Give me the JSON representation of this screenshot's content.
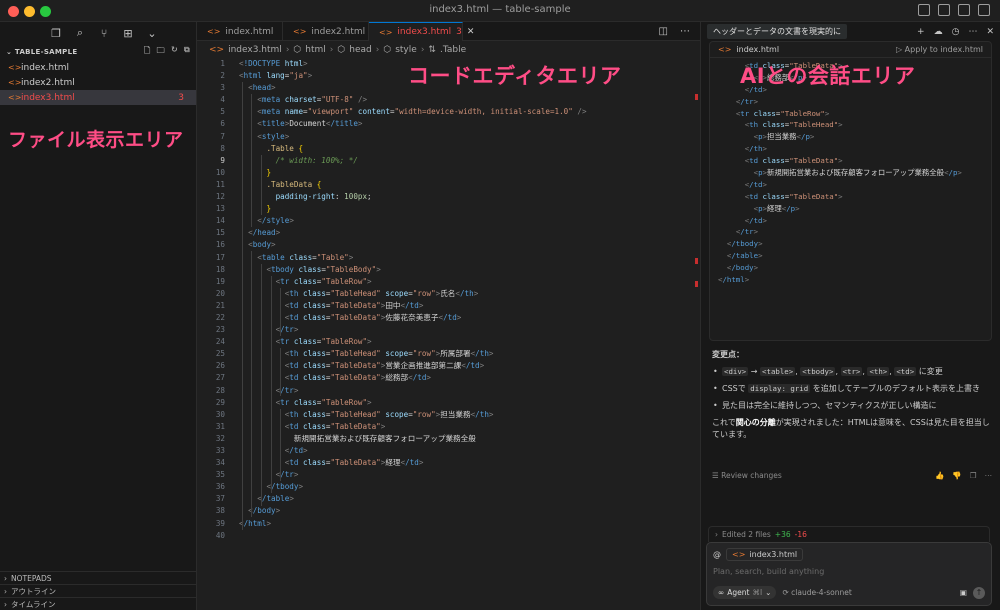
{
  "window": {
    "title": "index3.html — table-sample"
  },
  "colors": {
    "accent": "#0078d4",
    "error": "#f14c4c",
    "annotation": "#ff4d86",
    "html_icon": "#e37933"
  },
  "activity_icons": [
    "copy-icon",
    "search-icon",
    "source-control-icon",
    "extensions-icon",
    "chevron-down-icon"
  ],
  "explorer": {
    "title": "TABLE-SAMPLE",
    "files": [
      {
        "name": "index.html",
        "badge": ""
      },
      {
        "name": "index2.html",
        "badge": ""
      },
      {
        "name": "index3.html",
        "badge": "3"
      }
    ],
    "sections": [
      "NOTEPADS",
      "アウトライン",
      "タイムライン"
    ]
  },
  "annotations": {
    "file_area": "ファイル表示エリア",
    "code_area": "コードエディタエリア",
    "ai_area": "AIとの会話エリア"
  },
  "editor": {
    "tabs": [
      {
        "label": "index.html",
        "count": ""
      },
      {
        "label": "index2.html",
        "count": ""
      },
      {
        "label": "index3.html",
        "count": "3"
      }
    ],
    "breadcrumb": [
      "index3.html",
      "html",
      "head",
      "style",
      ".Table"
    ],
    "current_line": 9,
    "lines": [
      "<!DOCTYPE html>",
      "<html lang=\"ja\">",
      "  <head>",
      "    <meta charset=\"UTF-8\" />",
      "    <meta name=\"viewport\" content=\"width=device-width, initial-scale=1.0\" />",
      "    <title>Document</title>",
      "    <style>",
      "      .Table {",
      "        /* width: 100%; */",
      "      }",
      "      .TableData {",
      "        padding-right: 100px;",
      "      }",
      "    </style>",
      "  </head>",
      "  <body>",
      "    <table class=\"Table\">",
      "      <tbody class=\"TableBody\">",
      "        <tr class=\"TableRow\">",
      "          <th class=\"TableHead\" scope=\"row\">氏名</th>",
      "          <td class=\"TableData\">田中</td>",
      "          <td class=\"TableData\">佐藤花奈美恵子</td>",
      "        </tr>",
      "        <tr class=\"TableRow\">",
      "          <th class=\"TableHead\" scope=\"row\">所属部署</th>",
      "          <td class=\"TableData\">営業企画推進部第二課</td>",
      "          <td class=\"TableData\">総務部</td>",
      "        </tr>",
      "        <tr class=\"TableRow\">",
      "          <th class=\"TableHead\" scope=\"row\">担当業務</th>",
      "          <td class=\"TableData\">",
      "            新規開拓営業および既存顧客フォローアップ業務全般",
      "          </td>",
      "          <td class=\"TableData\">経理</td>",
      "        </tr>",
      "      </tbody>",
      "    </table>",
      "  </body>",
      "</html>",
      ""
    ]
  },
  "chat": {
    "tab_title": "ヘッダーとデータの文書を現実的に",
    "code_card": {
      "file": "index.html",
      "apply_label": "Apply to index.html",
      "lines": [
        "      <td class=\"TableData\">",
        "        <p>総務部</p>",
        "      </td>",
        "    </tr>",
        "    <tr class=\"TableRow\">",
        "      <th class=\"TableHead\">",
        "        <p>担当業務</p>",
        "      </th>",
        "      <td class=\"TableData\">",
        "        <p>新規開拓営業および既存顧客フォローアップ業務全般</p>",
        "      </td>",
        "      <td class=\"TableData\">",
        "        <p>経理</p>",
        "      </td>",
        "    </tr>",
        "  </tbody>",
        "  </table>",
        "  </body>",
        "</html>"
      ]
    },
    "changes_title": "変更点：",
    "changes": [
      {
        "codes": [
          "<div>",
          "<table>",
          "<tbody>",
          "<tr>",
          "<th>",
          "<td>"
        ],
        "arrow": "→",
        "text": "に変更"
      },
      {
        "pre": "CSSで",
        "code": "display: grid",
        "post": "を追加してテーブルのデフォルト表示を上書き"
      },
      {
        "text": "見た目は完全に維持しつつ、セマンティクスが正しい構造に"
      }
    ],
    "summary_pre": "これで",
    "summary_bold": "関心の分離",
    "summary_post": "が実現されました：HTMLは意味を、CSSは見た目を担当しています。",
    "review_label": "Review changes",
    "edited_label": "Edited 2 files",
    "added": "+36",
    "removed": "-16",
    "context_file": "index3.html",
    "input_placeholder": "Plan, search, build anything",
    "mode_label": "Agent",
    "mode_shortcut": "⌘I",
    "model_label": "claude-4-sonnet"
  }
}
